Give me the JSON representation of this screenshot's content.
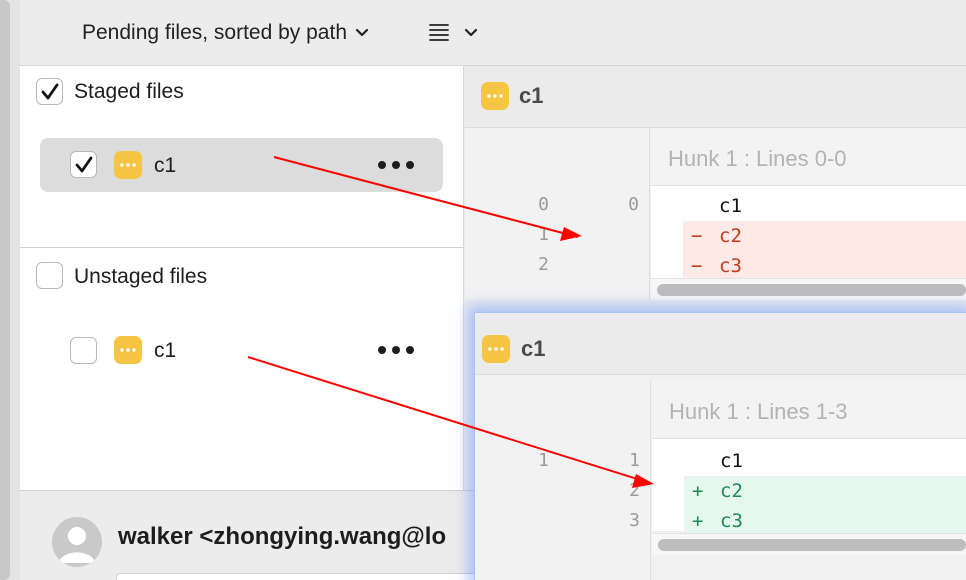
{
  "toolbar": {
    "sort_label": "Pending files, sorted by path",
    "sort_chevron_icon": "chevron-down-icon",
    "view_icon": "list-lines-icon"
  },
  "staged": {
    "section_label": "Staged files",
    "checked": true,
    "files": [
      {
        "name": "c1",
        "checked": true,
        "status_icon": "ellipsis-badge-icon",
        "more_icon": "more-horizontal-icon"
      }
    ]
  },
  "unstaged": {
    "section_label": "Unstaged files",
    "checked": false,
    "files": [
      {
        "name": "c1",
        "checked": false,
        "status_icon": "ellipsis-badge-icon",
        "more_icon": "more-horizontal-icon"
      }
    ]
  },
  "commit": {
    "author": "walker <zhongying.wang@lo"
  },
  "diff_staged": {
    "file_name": "c1",
    "hunk_title": "Hunk 1 : Lines 0-0",
    "lines": [
      {
        "old": "0",
        "new": "0",
        "sign": "",
        "text": "c1",
        "kind": "context"
      },
      {
        "old": "1",
        "new": "",
        "sign": "−",
        "text": "c2",
        "kind": "deleted"
      },
      {
        "old": "2",
        "new": "",
        "sign": "−",
        "text": "c3",
        "kind": "deleted"
      }
    ]
  },
  "diff_unstaged": {
    "file_name": "c1",
    "hunk_title": "Hunk 1 : Lines 1-3",
    "lines": [
      {
        "old": "1",
        "new": "1",
        "sign": "",
        "text": "c1",
        "kind": "context"
      },
      {
        "old": "",
        "new": "2",
        "sign": "+",
        "text": "c2",
        "kind": "added"
      },
      {
        "old": "",
        "new": "3",
        "sign": "+",
        "text": "c3",
        "kind": "added"
      }
    ]
  },
  "colors": {
    "badge": "#f5c543",
    "deleted_bg": "#fde9e6",
    "deleted_text": "#c23a1a",
    "added_bg": "#e5f7ee",
    "added_text": "#1f8a55",
    "annotation_arrow": "#ff0000",
    "focus_glow": "#6e96ff"
  }
}
